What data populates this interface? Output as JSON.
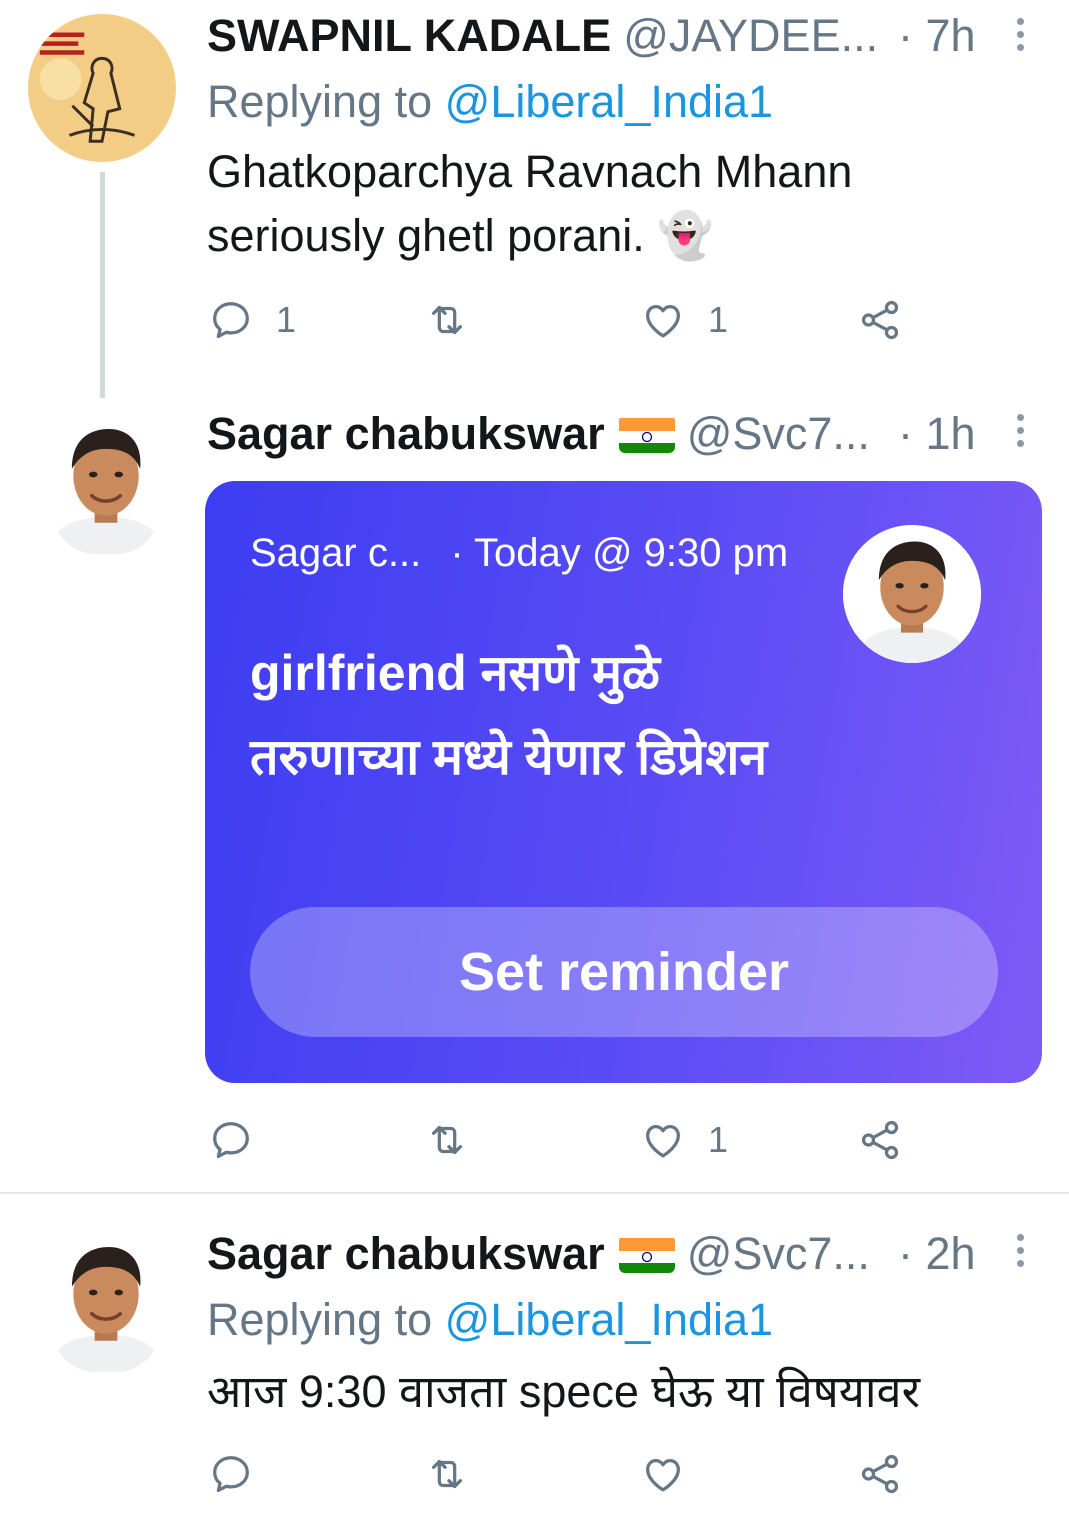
{
  "tweets": [
    {
      "name": "SWAPNIL KADALE",
      "handle": "@JAYDEE...",
      "time": "· 7h",
      "replying_label": "Replying to ",
      "replying_to": "@Liberal_India1",
      "text": "Ghatkoparchya Ravnach Mhann seriously ghetl porani. 👻",
      "reply_count": "1",
      "retweet_count": "",
      "like_count": "1"
    },
    {
      "name": "Sagar chabukswar",
      "handle": "@Svc7...",
      "time": "· 1h",
      "card": {
        "host": "Sagar c...",
        "schedule": "· Today @ 9:30 pm",
        "title": "girlfriend नसणे मुळे तरुणाच्या मध्ये येणार डिप्रेशन",
        "button": "Set reminder"
      },
      "reply_count": "",
      "retweet_count": "",
      "like_count": "1"
    },
    {
      "name": "Sagar chabukswar",
      "handle": "@Svc7...",
      "time": "· 2h",
      "replying_label": "Replying to ",
      "replying_to": "@Liberal_India1",
      "text": "आज 9:30 वाजता spece घेऊ या विषयावर",
      "reply_count": "",
      "retweet_count": "",
      "like_count": ""
    }
  ],
  "colors": {
    "link": "#1b95e0",
    "secondary_text": "#657786",
    "card_gradient_start": "#3c3df2",
    "card_gradient_end": "#7e5bf6"
  },
  "icons": [
    "reply-icon",
    "retweet-icon",
    "like-icon",
    "share-icon",
    "more-icon",
    "india-flag-icon"
  ]
}
